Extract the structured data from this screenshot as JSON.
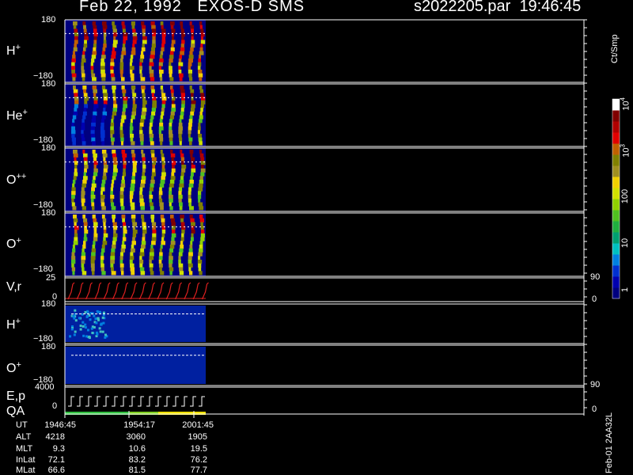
{
  "header": {
    "title": "Feb 22, 1992   EXOS-D SMS",
    "file_time": "s2022205.par  19:46:45"
  },
  "panels": [
    {
      "id": "h-plus-1",
      "label": "H",
      "sup": "+",
      "ymax": "180",
      "ymin": "−180"
    },
    {
      "id": "he-plus",
      "label": "He",
      "sup": "+",
      "ymax": "180",
      "ymin": "−180"
    },
    {
      "id": "o-plus-plus",
      "label": "O",
      "sup": "++",
      "ymax": "180",
      "ymin": "−180"
    },
    {
      "id": "o-plus-1",
      "label": "O",
      "sup": "+",
      "ymax": "180",
      "ymin": "−180"
    },
    {
      "id": "v-r",
      "label": "V,r",
      "sup": "",
      "ymax": "25",
      "ymin": "0",
      "rmax": "90",
      "rmin": "0"
    },
    {
      "id": "h-plus-2",
      "label": "H",
      "sup": "+",
      "ymax": "180",
      "ymin": "−180"
    },
    {
      "id": "o-plus-2",
      "label": "O",
      "sup": "+",
      "ymax": "180",
      "ymin": "−180"
    },
    {
      "id": "e-p-qa",
      "label": "E,p",
      "label2": "QA",
      "sup": "",
      "ymax": "4000",
      "ymin": "0",
      "rmax": "90",
      "rmin": "0"
    }
  ],
  "colorbar": {
    "title": "Ct/Smp",
    "ticks": [
      "1",
      "10",
      "100",
      "10",
      "10"
    ],
    "tick_sups": [
      "",
      "",
      "",
      "3",
      "4"
    ],
    "colors": [
      "#00007f",
      "#0000b0",
      "#0030d0",
      "#0080e0",
      "#00c0c0",
      "#00a070",
      "#20b040",
      "#50c020",
      "#90d000",
      "#d0e000",
      "#f0d000",
      "#a09020",
      "#808000",
      "#c06000",
      "#e00000",
      "#b00000",
      "#800000",
      "#ffffff"
    ]
  },
  "ephemeris": {
    "times": [
      "1946:45",
      "1954:17",
      "2001:45"
    ],
    "rows": [
      {
        "key": "UT",
        "values": [
          "",
          "",
          ""
        ]
      },
      {
        "key": "ALT",
        "values": [
          "4218",
          "3060",
          "1905"
        ]
      },
      {
        "key": "MLT",
        "values": [
          "9.3",
          "10.6",
          "19.5"
        ]
      },
      {
        "key": "InLat",
        "values": [
          "72.1",
          "83.2",
          "76.2"
        ]
      },
      {
        "key": "MLat",
        "values": [
          "66.6",
          "81.5",
          "77.7"
        ]
      }
    ]
  },
  "footer_id": "Feb-01  2AA32L",
  "chart_data": {
    "type": "heatmap",
    "title": "Feb 22, 1992   EXOS-D SMS",
    "xlabel": "UT",
    "x_ticks": [
      "1946:45",
      "1954:17",
      "2001:45"
    ],
    "series": [
      {
        "name": "H+",
        "ylim": [
          -180,
          180
        ]
      },
      {
        "name": "He+",
        "ylim": [
          -180,
          180
        ]
      },
      {
        "name": "O++",
        "ylim": [
          -180,
          180
        ]
      },
      {
        "name": "O+",
        "ylim": [
          -180,
          180
        ]
      },
      {
        "name": "V,r",
        "ylim": [
          0,
          25
        ],
        "ylim_right": [
          0,
          90
        ]
      },
      {
        "name": "H+",
        "ylim": [
          -180,
          180
        ]
      },
      {
        "name": "O+",
        "ylim": [
          -180,
          180
        ]
      },
      {
        "name": "E,p QA",
        "ylim": [
          0,
          4000
        ],
        "ylim_right": [
          0,
          90
        ]
      }
    ],
    "colorbar_label": "Ct/Smp",
    "colorbar_range": [
      "1",
      "10^4"
    ]
  }
}
